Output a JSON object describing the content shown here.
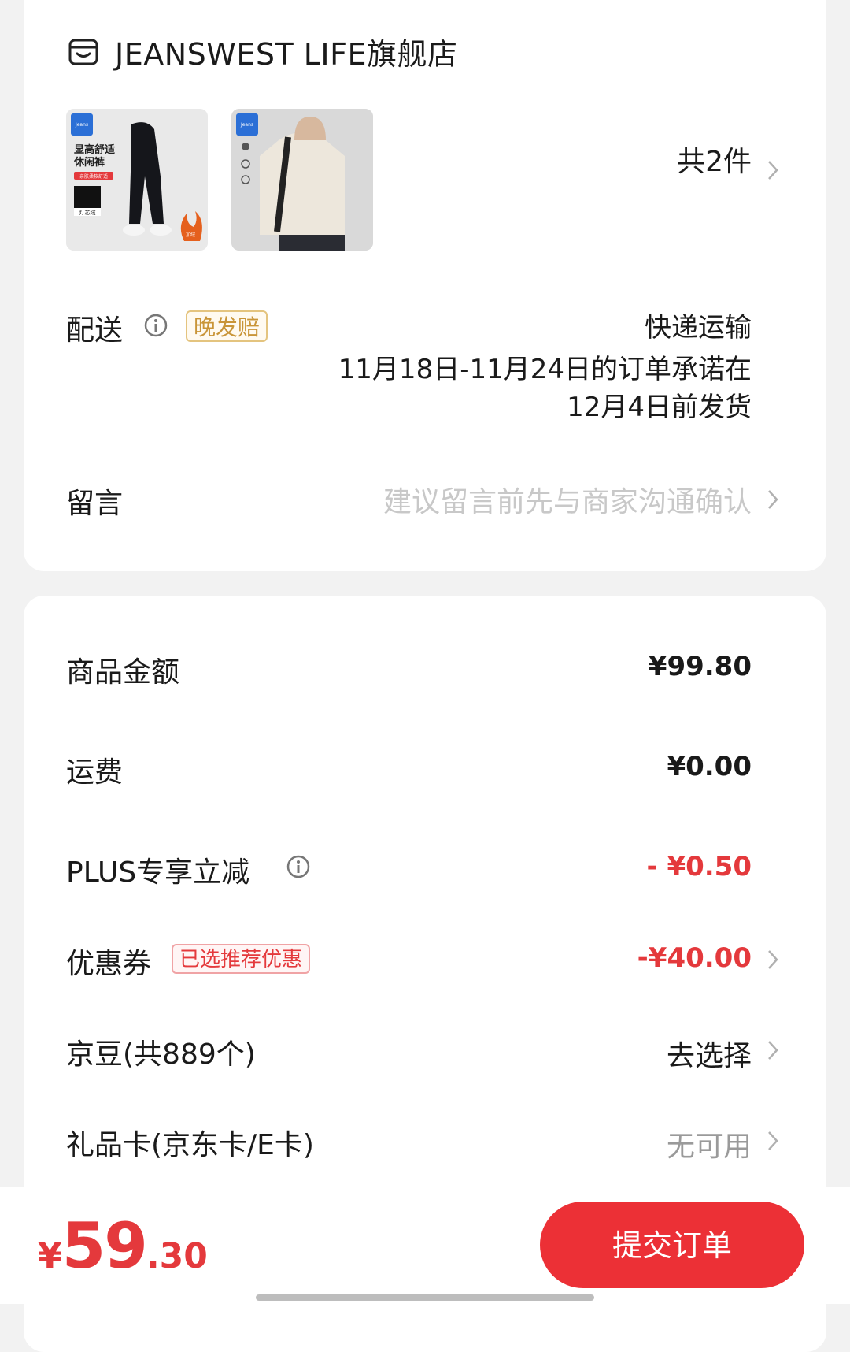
{
  "store": {
    "name": "JEANSWEST LIFE旗舰店"
  },
  "products": {
    "item1": {
      "brand": "Jeans West LIFE",
      "title_line1": "显高舒适",
      "title_line2": "休闲裤",
      "tag": "亲肤柔软舒适",
      "fabric": "灯芯绒",
      "flame_text": "加绒"
    },
    "item2": {
      "brand": "Jeans West LIFE"
    },
    "count_label": "共2件"
  },
  "delivery": {
    "label": "配送",
    "late_badge": "晚发赔",
    "method": "快递运输",
    "promise_line1": "11月18日-11月24日的订单承诺在",
    "promise_line2": "12月4日前发货"
  },
  "note": {
    "label": "留言",
    "placeholder": "建议留言前先与商家沟通确认"
  },
  "price": {
    "goods": {
      "label": "商品金额",
      "value": "¥99.80"
    },
    "shipping": {
      "label": "运费",
      "value": "¥0.00"
    },
    "plus": {
      "label": "PLUS专享立减",
      "value": "- ¥0.50"
    },
    "coupon": {
      "label": "优惠券",
      "badge": "已选推荐优惠",
      "value": "-¥40.00"
    },
    "jingdou": {
      "label": "京豆(共889个)",
      "value": "去选择"
    },
    "giftcard": {
      "label": "礼品卡(京东卡/E卡)",
      "value": "无可用"
    }
  },
  "footer": {
    "total_yen": "¥",
    "total_int": "59",
    "total_dec": ".30",
    "submit_label": "提交订单"
  },
  "colors": {
    "accent_red": "#e4393c",
    "badge_gold": "#c99538"
  }
}
